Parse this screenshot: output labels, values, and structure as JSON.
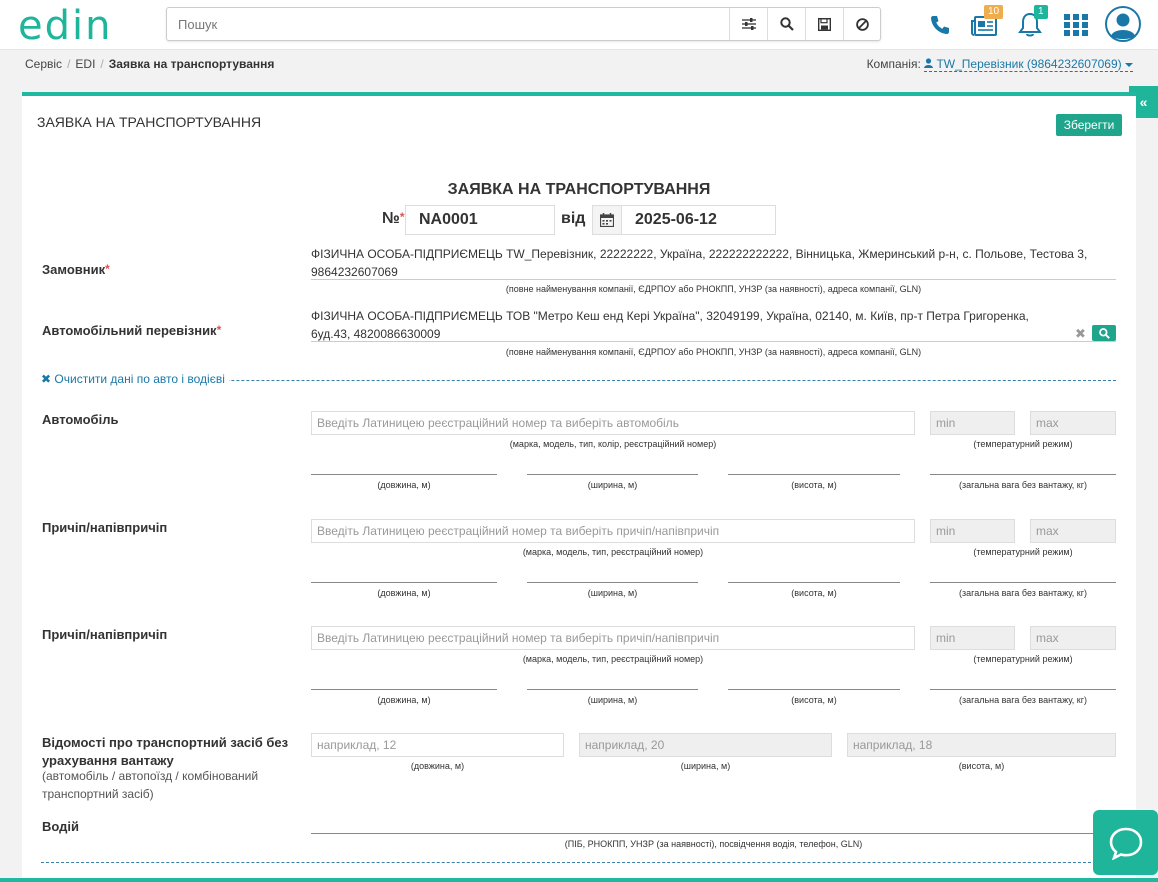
{
  "header": {
    "logo": "edin",
    "search_placeholder": "Пошук",
    "news_badge": "10",
    "notif_badge": "1"
  },
  "breadcrumb": {
    "items": [
      "Сервіс",
      "EDI"
    ],
    "current": "Заявка на транспортування"
  },
  "company": {
    "label": "Компанія:",
    "value": "TW_Перевізник (9864232607069)"
  },
  "card": {
    "title": "ЗАЯВКА НА ТРАНСПОРТУВАННЯ",
    "save_label": "Зберегти"
  },
  "doc": {
    "title": "ЗАЯВКА НА ТРАНСПОРТУВАННЯ",
    "number_label": "№",
    "number": "NA0001",
    "date_label": "від",
    "date": "2025-06-12"
  },
  "customer": {
    "label": "Замовник",
    "line1": "ФІЗИЧНА ОСОБА-ПІДПРИЄМЕЦЬ TW_Перевізник, 22222222, Україна, 222222222222, Вінницька, Жмеринський р-н, с. Польове, Тестова 3,",
    "line2": "9864232607069",
    "hint": "(повне найменування компанії, ЄДРПОУ або РНОКПП, УНЗР (за наявності), адреса компанії, GLN)"
  },
  "carrier": {
    "label": "Автомобільний перевізник",
    "line1": "ФІЗИЧНА ОСОБА-ПІДПРИЄМЕЦЬ ТОВ \"Метро Кеш енд Кері Україна\", 32049199, Україна, 02140, м. Київ, пр-т Петра Григоренка,",
    "line2": "6уд.43, 4820086630009",
    "hint": "(повне найменування компанії, ЄДРПОУ або РНОКПП, УНЗР (за наявності), адреса компанії, GLN)"
  },
  "clear_link": "Очистити дані по авто і водієві",
  "vehicle": {
    "label": "Автомобіль",
    "placeholder": "Введіть Латиницею реєстраційний номер та виберіть автомобіль",
    "hint": "(марка, модель, тип, колір, реєстраційний номер)"
  },
  "trailer1": {
    "label": "Причіп/напівпричіп",
    "placeholder": "Введіть Латиницею реєстраційний номер та виберіть причіп/напівпричіп",
    "hint": "(марка, модель, тип, реєстраційний номер)"
  },
  "trailer2": {
    "label": "Причіп/напівпричіп",
    "placeholder": "Введіть Латиницею реєстраційний номер та виберіть причіп/напівпричіп",
    "hint": "(марка, модель, тип, реєстраційний номер)"
  },
  "temp": {
    "min": "min",
    "max": "max",
    "hint": "(температурний режим)"
  },
  "dims": {
    "length": "(довжина, м)",
    "width": "(ширина, м)",
    "height": "(висота, м)",
    "weight": "(загальна вага без вантажу, кг)"
  },
  "empty_vehicle": {
    "label_line1": "Відомості про транспортний засіб без",
    "label_line2": "урахування вантажу",
    "sub_line1": "(автомобіль / автопоїзд / комбінований",
    "sub_line2": "транспортний засіб)",
    "length_placeholder": "наприклад, 12",
    "width_placeholder": "наприклад, 20",
    "height_placeholder": "наприклад, 18"
  },
  "driver": {
    "label": "Водій",
    "hint": "(ПІБ, РНОКПП, УНЗР (за наявності), посвідчення водія, телефон, GLN)"
  },
  "colors": {
    "accent": "#1fb59b",
    "link": "#1a78a8",
    "required": "#d9534f"
  }
}
